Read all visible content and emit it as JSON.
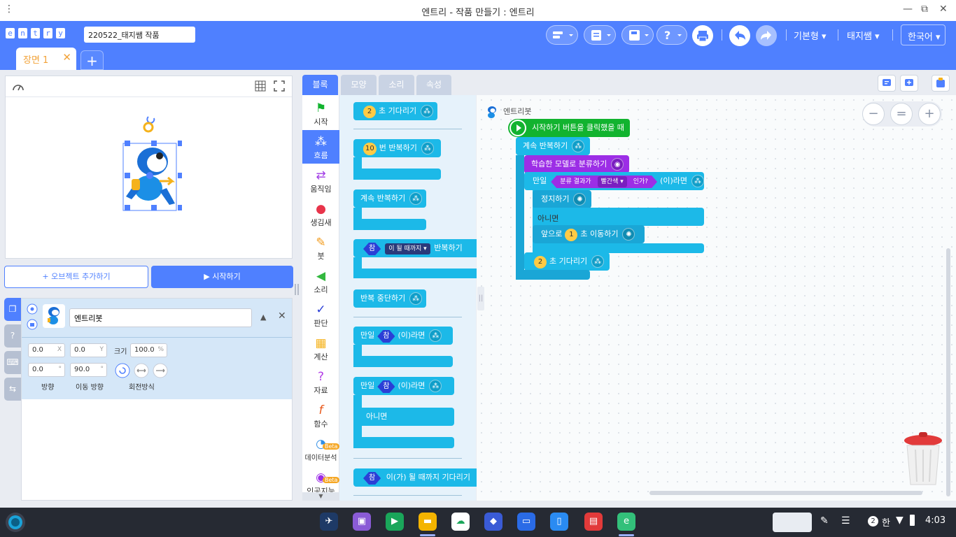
{
  "window": {
    "title": "엔트리 - 작품 만들기 : 엔트리",
    "menu_glyph": "⋮",
    "minimize": "—",
    "restore": "⧉",
    "close": "✕"
  },
  "header": {
    "logo_letters": [
      "e",
      "n",
      "t",
      "r",
      "y"
    ],
    "project_name": "220522_태지쌤 작품",
    "menus": {
      "mode": "기본형",
      "user": "태지쌤",
      "language": "한국어"
    }
  },
  "scene": {
    "tab_label": "장면 1",
    "close": "✕",
    "add": "+"
  },
  "stage": {
    "add_object_label": "+ 오브젝트 추가하기",
    "start_label": "▶ 시작하기"
  },
  "object": {
    "name": "엔트리봇",
    "x": "0.0",
    "x_unit": "X",
    "y": "0.0",
    "y_unit": "Y",
    "size_label": "크기",
    "size": "100.0",
    "size_unit": "%",
    "direction": "0.0",
    "direction_unit": "°",
    "move_direction": "90.0",
    "move_direction_unit": "°",
    "direction_label": "방향",
    "move_direction_label": "이동 방향",
    "rotation_label": "회전방식"
  },
  "block_tabs": [
    "블록",
    "모양",
    "소리",
    "속성"
  ],
  "categories": [
    {
      "label": "시작",
      "icon": "flag-icon"
    },
    {
      "label": "흐름",
      "icon": "flow-icon"
    },
    {
      "label": "움직임",
      "icon": "move-icon"
    },
    {
      "label": "생김새",
      "icon": "looks-icon"
    },
    {
      "label": "붓",
      "icon": "brush-icon"
    },
    {
      "label": "소리",
      "icon": "sound-icon"
    },
    {
      "label": "판단",
      "icon": "check-icon"
    },
    {
      "label": "계산",
      "icon": "calc-icon"
    },
    {
      "label": "자료",
      "icon": "data-icon"
    },
    {
      "label": "함수",
      "icon": "function-icon"
    },
    {
      "label": "데이터분석",
      "icon": "chart-icon",
      "badge": "Beta"
    },
    {
      "label": "인공지능",
      "icon": "ai-icon",
      "badge": "Beta"
    }
  ],
  "palette": {
    "wait_num": "2",
    "wait_text": "초 기다리기",
    "repeat_num": "10",
    "repeat_text": "번 반복하기",
    "forever_text": "계속 반복하기",
    "true_chip": "참",
    "until_dropdown": "이 될 때까지 ▾",
    "until_text": "반복하기",
    "stop_repeat_text": "반복 중단하기",
    "if_text": "만일",
    "if_suffix": "(이)라면",
    "else_text": "아니면",
    "wait_until_text": "이(가) 될 때까지 기다리기"
  },
  "script": {
    "sprite_name": "엔트리봇",
    "when_start": "시작하기 버튼을 클릭했을 때",
    "forever": "계속 반복하기",
    "classify": "학습한 모델로 분류하기",
    "if_label": "만일",
    "classify_result": "분류 결과가",
    "color_option": "빨간색 ▾",
    "is_q": "인가?",
    "if_suffix": "(이)라면",
    "stop": "정지하기",
    "else": "아니면",
    "forward": "앞으로",
    "forward_num": "1",
    "forward_suffix": "초 이동하기",
    "wait_num": "2",
    "wait_text": "초 기다리기"
  },
  "zoom": {
    "out": "−",
    "reset": "=",
    "in": "+"
  },
  "taskbar": {
    "ime_badge": "2",
    "ime_lang": "한",
    "time": "4:03"
  }
}
